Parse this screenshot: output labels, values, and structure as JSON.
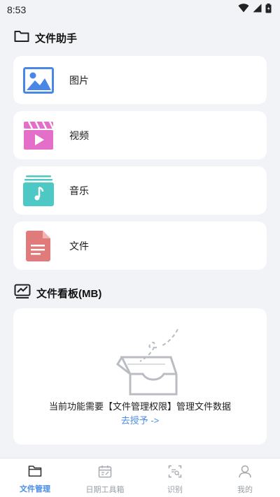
{
  "status_bar": {
    "time": "8:53",
    "icons": [
      "wifi-icon",
      "signal-icon",
      "battery-icon"
    ]
  },
  "file_assistant": {
    "title": "文件助手",
    "items": [
      {
        "label": "图片",
        "icon": "image-icon",
        "color": "#4a86e8"
      },
      {
        "label": "视频",
        "icon": "video-icon",
        "color": "#e46fc9"
      },
      {
        "label": "音乐",
        "icon": "music-icon",
        "color": "#4dc8c4"
      },
      {
        "label": "文件",
        "icon": "document-icon",
        "color": "#e07b7b"
      }
    ]
  },
  "file_board": {
    "title": "文件看板(MB)",
    "message": "当前功能需要【文件管理权限】管理文件数据",
    "link": "去授予 ->"
  },
  "bottom_nav": {
    "items": [
      {
        "label": "文件管理",
        "icon": "folder-icon",
        "active": true
      },
      {
        "label": "日期工具箱",
        "icon": "calendar-icon",
        "active": false
      },
      {
        "label": "识别",
        "icon": "scan-icon",
        "active": false
      },
      {
        "label": "我的",
        "icon": "user-icon",
        "active": false
      }
    ]
  },
  "colors": {
    "accent": "#4a8de8",
    "background": "#f1f3f7",
    "card": "#ffffff"
  }
}
